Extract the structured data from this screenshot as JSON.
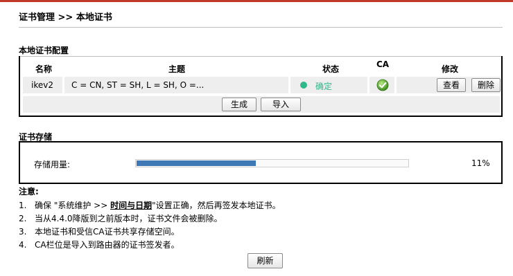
{
  "header": {
    "title": "证书管理 >> 本地证书"
  },
  "local_cert_section": {
    "title": "本地证书配置",
    "columns": {
      "name": "名称",
      "subject": "主题",
      "status": "状态",
      "ca": "CA",
      "modify": "修改"
    },
    "rows": [
      {
        "name": "ikev2",
        "subject": "C = CN, ST = SH, L = SH, O =...",
        "status": "确定",
        "status_color": "#2fb88b",
        "ca_icon": "check-icon",
        "view_label": "查看",
        "delete_label": "删除"
      }
    ],
    "generate_label": "生成",
    "import_label": "导入"
  },
  "storage_section": {
    "title": "证书存储",
    "usage_label": "存储用量:",
    "usage_fraction": 0.11,
    "usage_text": "11%",
    "bar_color": "#3e79b5"
  },
  "notes": {
    "title": "注意:",
    "items": [
      {
        "num": "1.",
        "prefix": "确保 \"系统维护 >> ",
        "link": "时间与日期",
        "suffix": "\"设置正确，然后再签发本地证书。"
      },
      {
        "num": "2.",
        "text": "当从4.4.0降版到之前版本时，证书文件会被删除。"
      },
      {
        "num": "3.",
        "text": "本地证书和受信CA证书共享存储空间。"
      },
      {
        "num": "4.",
        "text": "CA栏位是导入到路由器的证书签发者。"
      }
    ]
  },
  "refresh_label": "刷新"
}
